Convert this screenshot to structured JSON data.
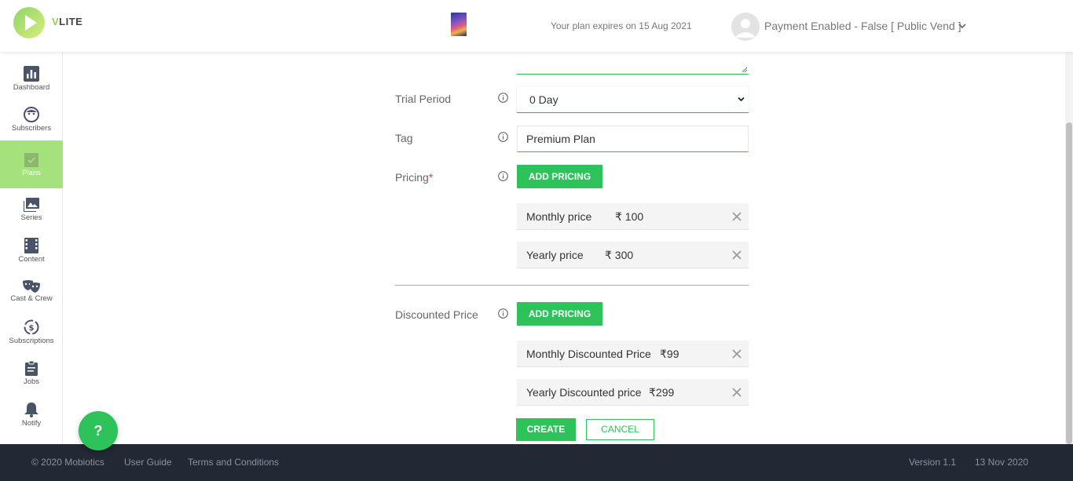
{
  "header": {
    "logo_text": "LITE",
    "logo_prefix": "V",
    "plan_expiry": "Your plan expires on 15 Aug 2021",
    "user_label": "Payment Enabled - False [ Public Vend ]"
  },
  "sidebar": {
    "items": [
      {
        "label": "Dashboard",
        "icon": "bar-chart-icon"
      },
      {
        "label": "Subscribers",
        "icon": "face-icon"
      },
      {
        "label": "Plans",
        "icon": "checkbox-icon",
        "active": true
      },
      {
        "label": "Series",
        "icon": "images-icon"
      },
      {
        "label": "Content",
        "icon": "film-icon"
      },
      {
        "label": "Cast & Crew",
        "icon": "masks-icon"
      },
      {
        "label": "Subscriptions",
        "icon": "dollar-cycle-icon"
      },
      {
        "label": "Jobs",
        "icon": "clipboard-icon"
      },
      {
        "label": "Notify",
        "icon": "bell-icon"
      }
    ]
  },
  "form": {
    "trial_period": {
      "label": "Trial Period",
      "value": "0 Day"
    },
    "tag": {
      "label": "Tag",
      "value": "Premium Plan"
    },
    "pricing": {
      "label": "Pricing",
      "required_mark": "*",
      "add_button": "ADD PRICING",
      "rows": [
        {
          "label": "Monthly price",
          "value": "₹ 100"
        },
        {
          "label": "Yearly price",
          "value": "₹ 300"
        }
      ]
    },
    "discounted": {
      "label": "Discounted Price",
      "add_button": "ADD PRICING",
      "rows": [
        {
          "label": "Monthly Discounted Price",
          "value": "₹99"
        },
        {
          "label": "Yearly Discounted price",
          "value": "₹299"
        }
      ]
    },
    "create_button": "CREATE",
    "cancel_button": "CANCEL"
  },
  "help_button": "?",
  "footer": {
    "copyright": "© 2020 Mobiotics",
    "user_guide": "User Guide",
    "terms": "Terms and Conditions",
    "version": "Version 1.1",
    "date": "13 Nov 2020"
  },
  "colors": {
    "accent": "#2dc25a",
    "sidebar_active": "#a4e27c",
    "footer_bg": "#222834"
  }
}
